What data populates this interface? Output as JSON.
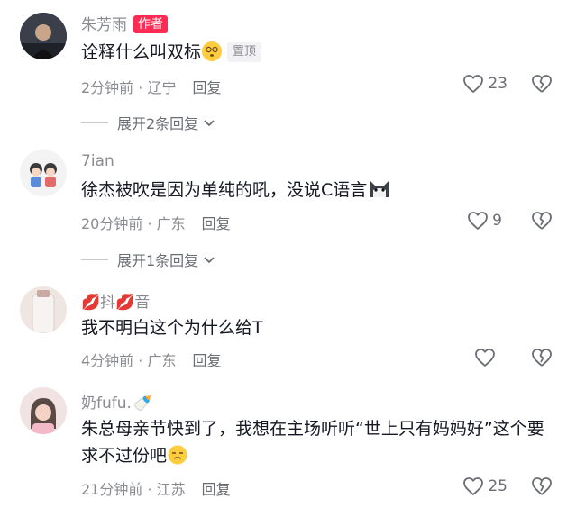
{
  "comments": [
    {
      "username": "朱芳雨",
      "author_tag": "作者",
      "text": "诠释什么叫双标",
      "pin_tag": "置顶",
      "time": "2分钟前",
      "location": "辽宁",
      "reply_label": "回复",
      "likes": "23",
      "expand_label": "展开2条回复"
    },
    {
      "username": "7ian",
      "text": "徐杰被吹是因为单纯的吼，没说C语言",
      "time": "20分钟前",
      "location": "广东",
      "reply_label": "回复",
      "likes": "9",
      "expand_label": "展开1条回复"
    },
    {
      "username": "抖",
      "username_suffix": "音",
      "text": "我不明白这个为什么给T",
      "time": "4分钟前",
      "location": "广东",
      "reply_label": "回复"
    },
    {
      "username": "奶fufu.",
      "text": "朱总母亲节快到了，我想在主场听听“世上只有妈妈好”这个要求不过份吧",
      "time": "21分钟前",
      "location": "江苏",
      "reply_label": "回复",
      "likes": "25"
    }
  ],
  "colors": {
    "accent": "#fe2c55",
    "muted": "#8a8b91"
  }
}
